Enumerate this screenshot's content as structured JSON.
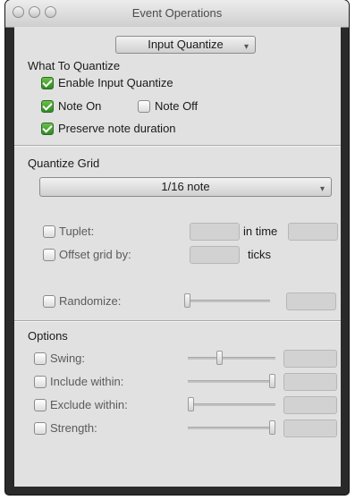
{
  "window": {
    "title": "Event Operations"
  },
  "operation_menu": {
    "value": "Input Quantize"
  },
  "what_to_quantize": {
    "title": "What To Quantize",
    "enable": {
      "label": "Enable Input Quantize",
      "checked": true
    },
    "note_on": {
      "label": "Note On",
      "checked": true
    },
    "note_off": {
      "label": "Note Off",
      "checked": false
    },
    "preserve": {
      "label": "Preserve note duration",
      "checked": true
    }
  },
  "quantize_grid": {
    "title": "Quantize Grid",
    "grid_value": "1/16 note",
    "tuplet": {
      "label": "Tuplet:",
      "checked": false,
      "mid_label": "in time"
    },
    "offset": {
      "label": "Offset grid by:",
      "checked": false,
      "unit": "ticks"
    },
    "randomize": {
      "label": "Randomize:",
      "checked": false,
      "slider_level": 0.0
    }
  },
  "options": {
    "title": "Options",
    "swing": {
      "label": "Swing:",
      "checked": false,
      "slider_level": 0.35
    },
    "include": {
      "label": "Include within:",
      "checked": false,
      "slider_level": 1.0
    },
    "exclude": {
      "label": "Exclude within:",
      "checked": false,
      "slider_level": 0.0
    },
    "strength": {
      "label": "Strength:",
      "checked": false,
      "slider_level": 1.0
    }
  },
  "icons": {
    "close": "close-traffic-light-icon",
    "minimize": "minimize-traffic-light-icon",
    "zoom": "zoom-traffic-light-icon",
    "dropdown": "chevron-down-icon",
    "check": "checkmark-icon"
  }
}
